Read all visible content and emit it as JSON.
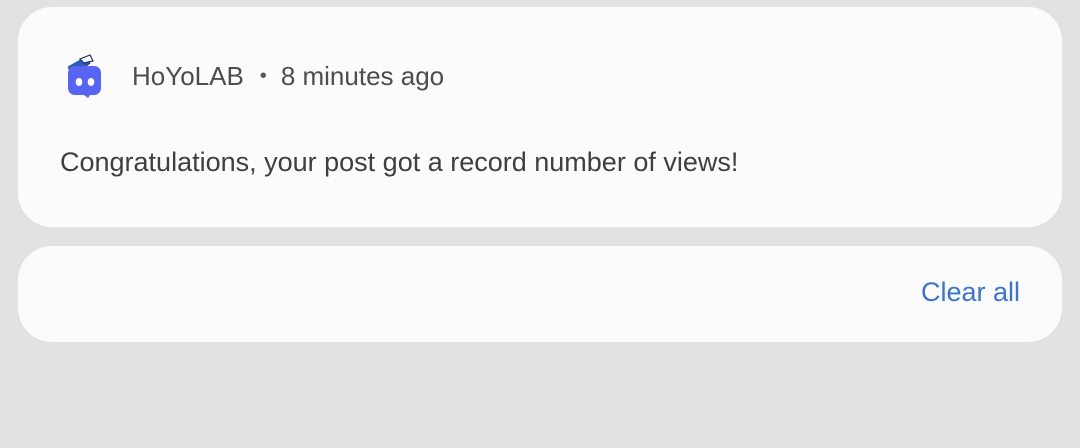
{
  "notification": {
    "app_icon": "discord-style-app-icon",
    "app_name": "HoYoLAB",
    "separator": "•",
    "time": "8 minutes ago",
    "message": "Congratulations, your post got a record number of views!"
  },
  "footer": {
    "clear_all_label": "Clear all"
  },
  "colors": {
    "background": "#e2e2e2",
    "card": "#fbfbfb",
    "accent": "#3c74c8",
    "icon_blue": "#5865f2"
  }
}
